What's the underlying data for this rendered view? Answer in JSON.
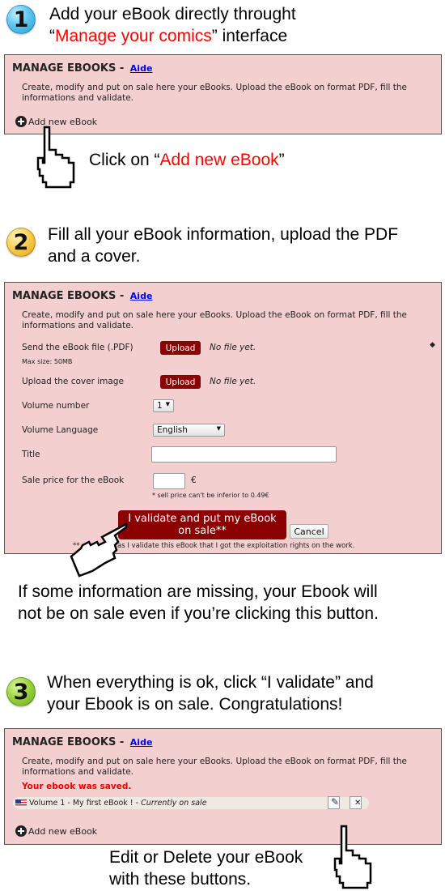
{
  "step1": {
    "number": "1",
    "line1": "Add your eBook directly throught",
    "line2_open_quote": "“",
    "line2_highlight": "Manage your comics",
    "line2_close": "” interface",
    "callout_prefix": "Click on “",
    "callout_highlight": "Add new eBook",
    "callout_suffix": "”"
  },
  "step2": {
    "number": "2",
    "line1": "Fill all your eBook information, upload the PDF",
    "line2": "and a cover.",
    "warning_line1": "If some information are missing, your Ebook will",
    "warning_line2": "not be on sale even if you’re clicking this button."
  },
  "step3": {
    "number": "3",
    "line1": "When everything is ok, click “I validate” and",
    "line2": "your Ebook is on sale. Congratulations!",
    "callout_line1": "Edit or Delete your eBook",
    "callout_line2": "with these buttons."
  },
  "panel": {
    "title": "MANAGE EBOOKS -",
    "help_link": "Aide",
    "description": "Create, modify and put on sale here your eBooks. Upload the eBook on format PDF, fill the informations and validate.",
    "add_new_label": "Add new eBook"
  },
  "form": {
    "pdf_label": "Send the eBook file (.PDF)",
    "pdf_max_size": "Max size: 50MB",
    "pdf_upload_button": "Upload",
    "pdf_status": "No file yet.",
    "cover_label": "Upload the cover image",
    "cover_upload_button": "Upload",
    "cover_status": "No file yet.",
    "volume_label": "Volume number",
    "volume_value": "1",
    "language_label": "Volume Language",
    "language_value": "English",
    "title_label": "Title",
    "title_value": "",
    "price_label": "Sale price for the eBook",
    "price_value": "",
    "currency": "€",
    "price_note": "* sell price can't be inferior to 0.49€",
    "validate_button_line1": "I validate and put my eBook",
    "validate_button_line2": "on sale**",
    "cancel_button": "Cancel",
    "footnote_prefix": "**",
    "footnote_visible": "as I validate this eBook that I got the exploitation rights on the work."
  },
  "result": {
    "saved_message": "Your ebook was saved.",
    "ebook_entry": "Volume 1 - My first eBook ! - ",
    "ebook_status": "Currently on sale",
    "ebook_language_flag": "flag-uk-icon"
  },
  "colors": {
    "panel_bg": "#f3cfcf",
    "button_bg": "#8b0000",
    "highlight_red": "#ff0000",
    "link_blue": "#0000ee"
  }
}
